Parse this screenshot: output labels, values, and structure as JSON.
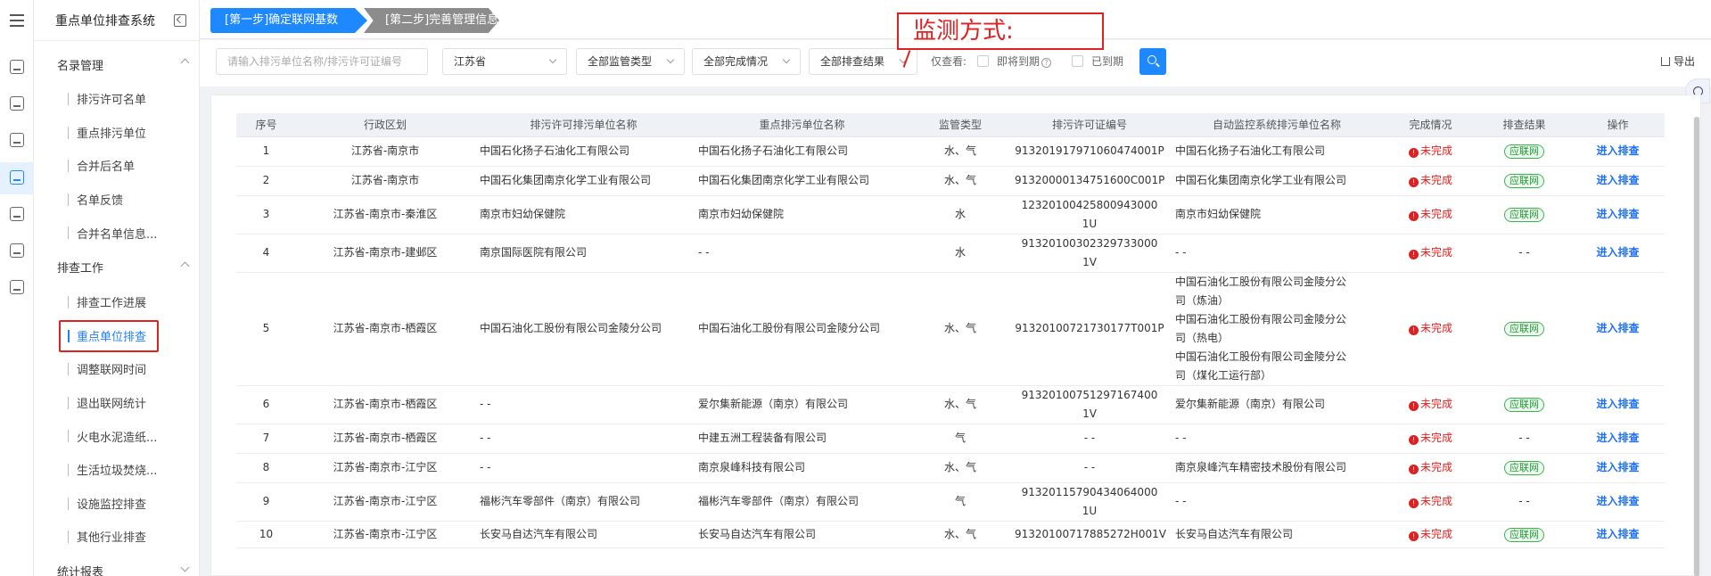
{
  "app": {
    "title": "重点单位排查系统"
  },
  "steps": [
    {
      "label": "[第一步]确定联网基数",
      "active": true
    },
    {
      "label": "[第二步]完善管理信息",
      "active": false
    }
  ],
  "annotation": {
    "text": "监测方式:"
  },
  "menu": {
    "groups": [
      {
        "label": "名录管理",
        "items": [
          "排污许可名单",
          "重点排污单位",
          "合并后名单",
          "名单反馈",
          "合并名单信息..."
        ]
      },
      {
        "label": "排查工作",
        "items": [
          "排查工作进展",
          "重点单位排查",
          "调整联网时间",
          "退出联网统计",
          "火电水泥造纸...",
          "生活垃圾焚烧...",
          "设施监控排查",
          "其他行业排查"
        ]
      },
      {
        "label": "统计报表",
        "items": []
      }
    ],
    "active_item": "重点单位排查"
  },
  "filters": {
    "search_placeholder": "请输入排污单位名称/排污许可证编号",
    "province": "江苏省",
    "supervision_type": "全部监管类型",
    "completion": "全部完成情况",
    "result": "全部排查结果",
    "only_view_label": "仅查看:",
    "expiring_label": "即将到期",
    "expired_label": "已到期",
    "export_label": "导出"
  },
  "table": {
    "columns": [
      "序号",
      "行政区划",
      "排污许可排污单位名称",
      "重点排污单位名称",
      "监管类型",
      "排污许可证编号",
      "自动监控系统排污单位名称",
      "完成情况",
      "排查结果",
      "操作"
    ],
    "rows": [
      {
        "no": "1",
        "region": "江苏省-南京市",
        "permit_name": "中国石化扬子石油化工有限公司",
        "key_name": "中国石化扬子石油化工有限公司",
        "type": "水、气",
        "permit_no": "913201917971060474001P",
        "monitor_names": [
          "中国石化扬子石油化工有限公司"
        ],
        "status": "未完成",
        "result": "应联网",
        "action": "进入排查"
      },
      {
        "no": "2",
        "region": "江苏省-南京市",
        "permit_name": "中国石化集团南京化学工业有限公司",
        "key_name": "中国石化集团南京化学工业有限公司",
        "type": "水、气",
        "permit_no": "91320000134751600C001P",
        "monitor_names": [
          "中国石化集团南京化学工业有限公司"
        ],
        "status": "未完成",
        "result": "应联网",
        "action": "进入排查"
      },
      {
        "no": "3",
        "region": "江苏省-南京市-秦淮区",
        "permit_name": "南京市妇幼保健院",
        "key_name": "南京市妇幼保健院",
        "type": "水",
        "permit_no": "12320100425800943000 1U",
        "monitor_names": [
          "南京市妇幼保健院"
        ],
        "status": "未完成",
        "result": "应联网",
        "action": "进入排查"
      },
      {
        "no": "4",
        "region": "江苏省-南京市-建邺区",
        "permit_name": "南京国际医院有限公司",
        "key_name": "- -",
        "type": "水",
        "permit_no": "91320100302329733000 1V",
        "monitor_names": [
          "- -"
        ],
        "status": "未完成",
        "result": "- -",
        "action": "进入排查"
      },
      {
        "no": "5",
        "region": "江苏省-南京市-栖霞区",
        "permit_name": "中国石油化工股份有限公司金陵分公司",
        "key_name": "中国石油化工股份有限公司金陵分公司",
        "type": "水、气",
        "permit_no": "91320100721730177T001P",
        "monitor_names": [
          "中国石油化工股份有限公司金陵分公",
          "司（炼油）",
          "中国石油化工股份有限公司金陵分公",
          "司（热电）",
          "中国石油化工股份有限公司金陵分公",
          "司（煤化工运行部）"
        ],
        "status": "未完成",
        "result": "应联网",
        "action": "进入排查"
      },
      {
        "no": "6",
        "region": "江苏省-南京市-栖霞区",
        "permit_name": "- -",
        "key_name": "爱尔集新能源（南京）有限公司",
        "type": "水、气",
        "permit_no": "91320100751297167400 1V",
        "monitor_names": [
          "爱尔集新能源（南京）有限公司"
        ],
        "status": "未完成",
        "result": "应联网",
        "action": "进入排查"
      },
      {
        "no": "7",
        "region": "江苏省-南京市-栖霞区",
        "permit_name": "- -",
        "key_name": "中建五洲工程装备有限公司",
        "type": "气",
        "permit_no": "- -",
        "monitor_names": [
          "- -"
        ],
        "status": "未完成",
        "result": "- -",
        "action": "进入排查"
      },
      {
        "no": "8",
        "region": "江苏省-南京市-江宁区",
        "permit_name": "- -",
        "key_name": "南京泉峰科技有限公司",
        "type": "水、气",
        "permit_no": "- -",
        "monitor_names": [
          "南京泉峰汽车精密技术股份有限公司"
        ],
        "status": "未完成",
        "result": "应联网",
        "action": "进入排查"
      },
      {
        "no": "9",
        "region": "江苏省-南京市-江宁区",
        "permit_name": "福彬汽车零部件（南京）有限公司",
        "key_name": "福彬汽车零部件（南京）有限公司",
        "type": "气",
        "permit_no": "91320115790434064000 1U",
        "monitor_names": [
          "- -"
        ],
        "status": "未完成",
        "result": "- -",
        "action": "进入排查"
      },
      {
        "no": "10",
        "region": "江苏省-南京市-江宁区",
        "permit_name": "长安马自达汽车有限公司",
        "key_name": "长安马自达汽车有限公司",
        "type": "水、气",
        "permit_no": "91320100717885272H001V",
        "monitor_names": [
          "长安马自达汽车有限公司"
        ],
        "status": "未完成",
        "result": "应联网",
        "action": "进入排查"
      }
    ]
  },
  "colors": {
    "primary": "#1e88ff",
    "danger": "#e02020",
    "success": "#39b54a"
  }
}
